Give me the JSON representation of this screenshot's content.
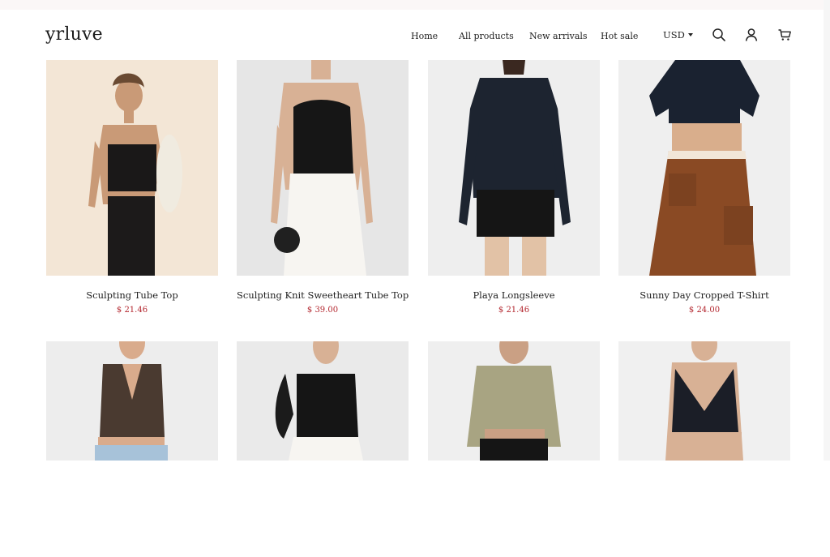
{
  "brand": {
    "logo": "yrluve"
  },
  "nav": {
    "items": [
      {
        "label": "Home"
      },
      {
        "label": "All products"
      },
      {
        "label": "New arrivals"
      },
      {
        "label": "Hot sale"
      }
    ],
    "currency": "USD"
  },
  "icons": {
    "search": "search-icon",
    "account": "user-icon",
    "cart": "cart-icon"
  },
  "products": [
    {
      "name": "Sculpting Tube Top",
      "price": "$ 21.46"
    },
    {
      "name": "Sculpting Knit Sweetheart Tube Top",
      "price": "$ 39.00"
    },
    {
      "name": "Playa Longsleeve",
      "price": "$ 21.46"
    },
    {
      "name": "Sunny Day Cropped T-Shirt",
      "price": "$ 24.00"
    },
    {
      "name": "",
      "price": ""
    },
    {
      "name": "",
      "price": ""
    },
    {
      "name": "",
      "price": ""
    },
    {
      "name": "",
      "price": ""
    }
  ],
  "colors": {
    "price": "#b3262e",
    "text": "#1f1f1f"
  }
}
